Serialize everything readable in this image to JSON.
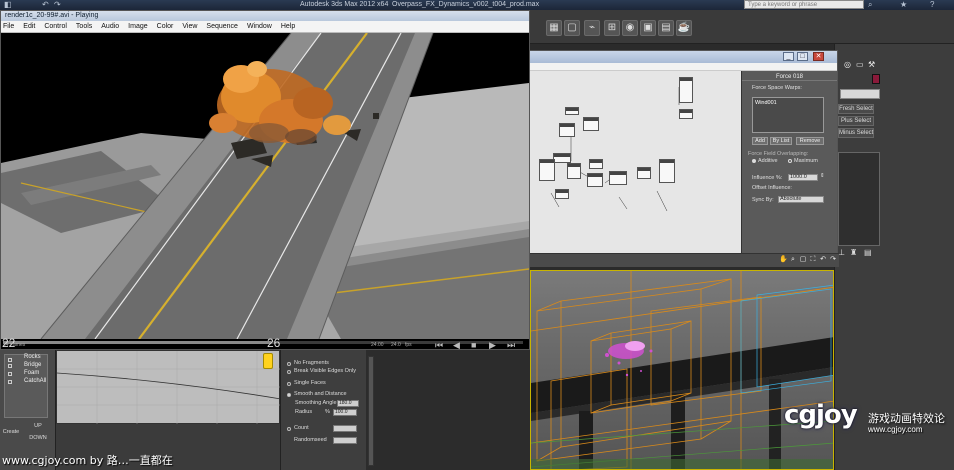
{
  "max_window": {
    "title": "Autodesk 3ds Max 2012 x64",
    "file": "Overpass_FX_Dynamics_v002_t004_prod.max",
    "help_search_placeholder": "Type a keyword or phrase"
  },
  "ram_player": {
    "title": "render1c_20-99#.avi - Playing",
    "menu": [
      "File",
      "Edit",
      "Control",
      "Tools",
      "Audio",
      "Image",
      "Color",
      "View",
      "Sequence",
      "Window",
      "Help"
    ],
    "frame_start": "22",
    "frame_current": "26",
    "frames_label": "34 frames",
    "time_label": "24.00",
    "fps_value": "24.0",
    "fps_label": "fps"
  },
  "particle_view": {
    "force_panel": {
      "title": "Force 018",
      "force_space_warps_label": "Force Space Warps:",
      "list_items": [
        "Wind001"
      ],
      "add_button": "Add",
      "by_list_button": "By List",
      "remove_button": "Remove",
      "overlap_label": "Force Field Overlapping:",
      "additive_label": "Additive",
      "maximum_label": "Maximum",
      "influence_label": "Influence %:",
      "influence_value": "1000.0",
      "offset_label": "Offset Influence:",
      "sync_by_label": "Sync By:",
      "sync_by_value": "Absolute"
    }
  },
  "command_panel": {
    "buttons": [
      "Fresh Select",
      "Plus Select",
      "Minus Select"
    ]
  },
  "scene_explorer": {
    "items": [
      "Rocks",
      "Bridge",
      "Foam",
      "CatchAll"
    ],
    "create_button": "Create",
    "up_button": "UP",
    "down_button": "DOWN"
  },
  "modifier_panel": {
    "options": [
      {
        "label": "No Fragments",
        "selected": false
      },
      {
        "label": "Break Visible Edges Only",
        "selected": false
      },
      {
        "label": "Single Faces",
        "selected": false
      },
      {
        "label": "Smooth and Distance",
        "selected": true
      }
    ],
    "smoothing_angle_label": "Smoothing Angle",
    "smoothing_angle_value": "180.0",
    "radius_label": "Radius",
    "radius_unit": "%",
    "radius_value": "100.0",
    "count_label": "Count",
    "randomseed_label": "Randomseed"
  },
  "watermark": {
    "footer_text": "www.cgjoy.com by 路…一直都在",
    "logo": "cgjoy",
    "logo_cn": "游戏动画特效论",
    "logo_url": "www.cgjoy.com"
  },
  "colors": {
    "accent_yellow": "#ffd21e",
    "road_gray": "#6c6c6c",
    "fire_orange": "#e08a2c",
    "wire_orange": "#d98a1a",
    "particle_magenta": "#d050d0"
  }
}
